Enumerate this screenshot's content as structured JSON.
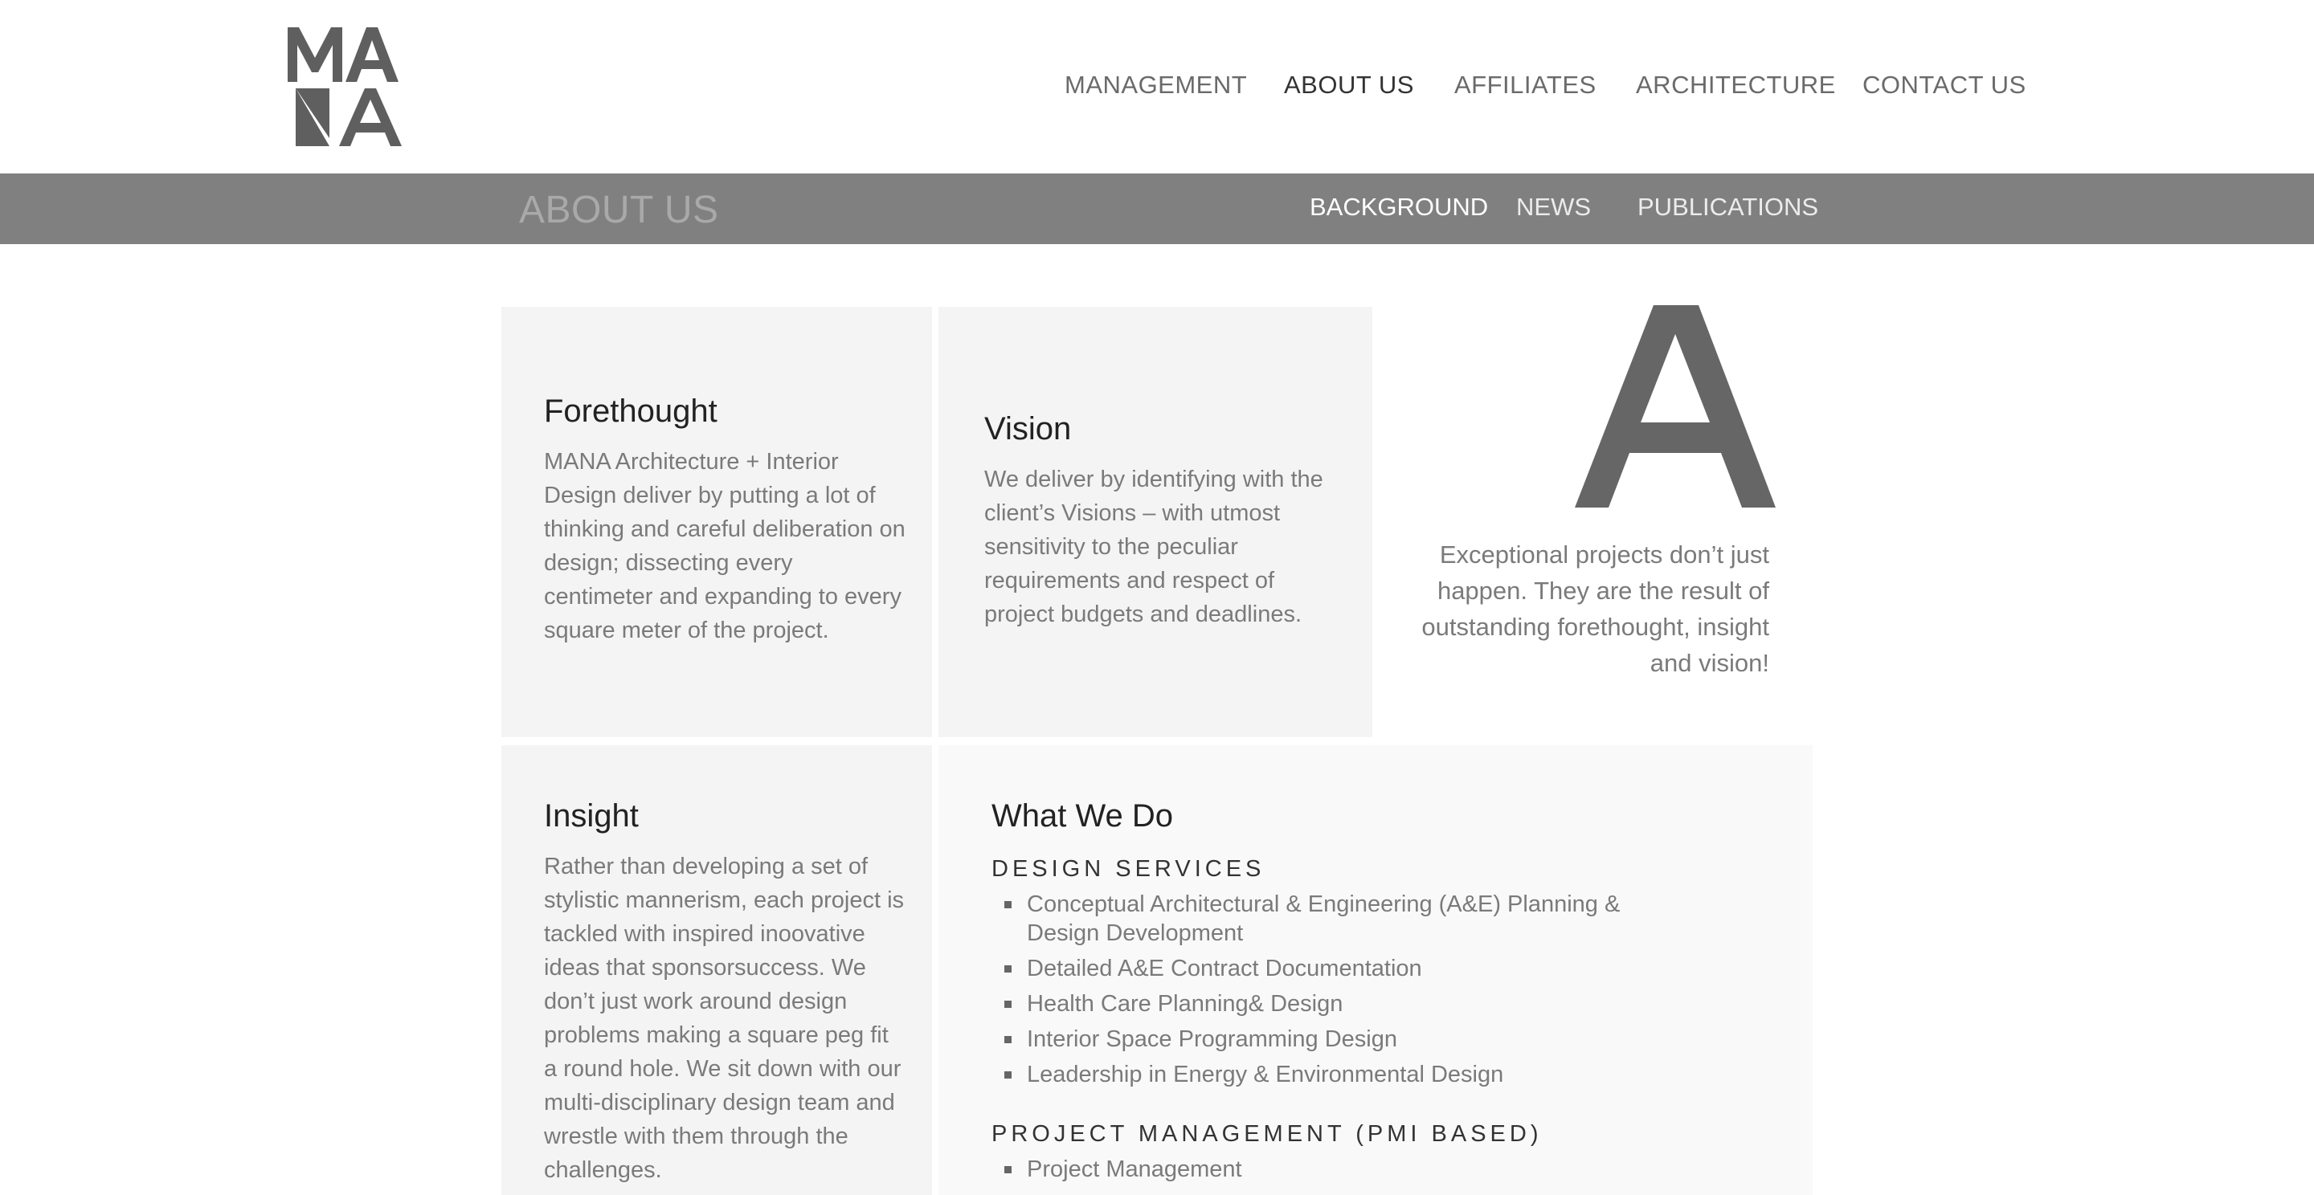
{
  "brand": {
    "logo_text": "MANA"
  },
  "nav": {
    "items": [
      "MANAGEMENT",
      "ABOUT US",
      "AFFILIATES",
      "ARCHITECTURE",
      "CONTACT US"
    ],
    "active": "ABOUT US"
  },
  "subbar": {
    "title": "ABOUT US",
    "items": [
      "BACKGROUND",
      "NEWS",
      "PUBLICATIONS"
    ],
    "active": "BACKGROUND"
  },
  "cards": {
    "forethought": {
      "title": "Forethought",
      "body": "MANA Architecture + Interior Design deliver by putting a lot of thinking and careful deliberation on design; dissecting every centimeter and expanding to every square meter of the project."
    },
    "vision": {
      "title": "Vision",
      "body": "We deliver by identifying with the client’s Visions – with utmost sensitivity to the peculiar requirements and respect of project budgets and deadlines."
    },
    "insight": {
      "title": "Insight",
      "body": "Rather than developing a set of stylistic mannerism, each project is tackled with inspired inoovative ideas that sponsorsuccess. We don’t just work around design problems making a square peg fit a round hole. We sit down with our multi-disciplinary design team and wrestle with them through the challenges."
    }
  },
  "feature": {
    "letter": "A",
    "quote": "Exceptional projects don’t just happen. They are the result of outstanding forethought, insight and vision!"
  },
  "what_we_do": {
    "title": "What We Do",
    "design_label": "DESIGN SERVICES",
    "design_items": [
      "Conceptual Architectural & Engineering (A&E) Planning & Design Development",
      "Detailed A&E Contract Documentation",
      "Health Care Planning& Design",
      "Interior Space Programming Design",
      "Leadership in Energy & Environmental Design"
    ],
    "pm_label": "PROJECT MANAGEMENT (PMI BASED)",
    "pm_items": [
      "Project Management"
    ]
  },
  "colors": {
    "subbar_bg": "#808080",
    "card_bg": "#f4f4f4",
    "logo_gray": "#5f5f5f"
  }
}
